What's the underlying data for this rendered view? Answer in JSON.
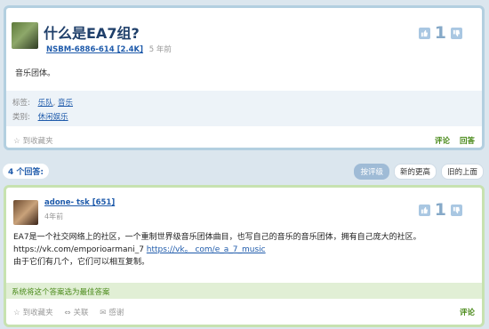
{
  "question": {
    "title": "什么是EA7组?",
    "user": "NSBM-6886-614 [2.4K]",
    "time": "5 年前",
    "votes": "1",
    "body": "音乐团体。",
    "tags_label": "标签:",
    "tags": [
      "乐队",
      "音乐"
    ],
    "category_label": "类别:",
    "category": "休闲娱乐",
    "favorite": "到收藏夹",
    "comment": "评论",
    "answer": "回答"
  },
  "answers_header": {
    "count": "4 个回答:",
    "sort_votes": "按评级",
    "sort_newest": "新的更高",
    "sort_oldest": "旧的上面"
  },
  "answer": {
    "user": "adone- tsk [651]",
    "time": "4年前",
    "votes": "1",
    "line1": "EA7是一个社交网络上的社区，一个重制世界级音乐团体曲目，也写自己的音乐的音乐团体，拥有自己庞大的社区。",
    "line2_text": "https://vk.com/emporioarmani_7",
    "line2_link": "https://vk。 com/e_a_7_music",
    "line3": "由于它们有几个，它们可以相互复制。",
    "best_notice": "系统将这个答案选为最佳答案",
    "favorite": "到收藏夹",
    "follow": "关联",
    "thanks": "感谢",
    "comment": "评论"
  }
}
